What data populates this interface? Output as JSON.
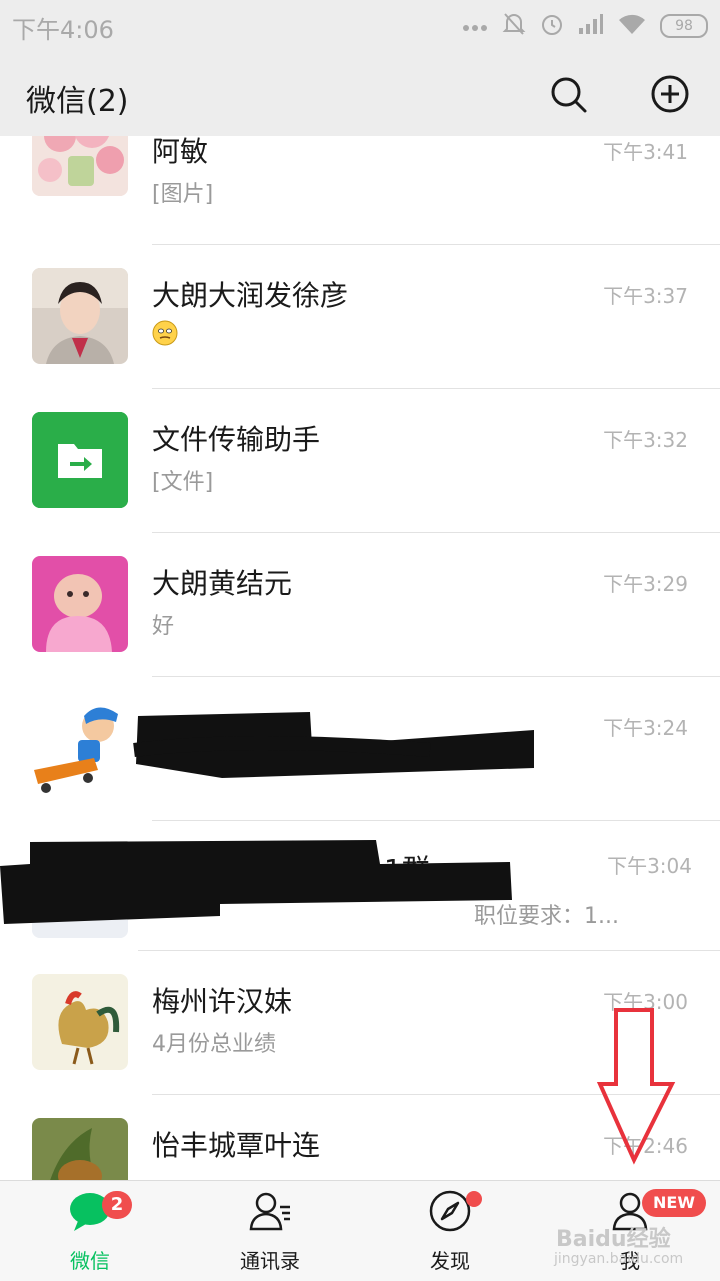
{
  "status_bar": {
    "time": "下午4:06",
    "battery": "98"
  },
  "header": {
    "title": "微信(2)"
  },
  "chats": [
    {
      "name": "阿敏",
      "message": "[图片]",
      "time": "下午3:41"
    },
    {
      "name": "大朗大润发徐彦",
      "message": "",
      "time": "下午3:37"
    },
    {
      "name": "文件传输助手",
      "message": "[文件]",
      "time": "下午3:32"
    },
    {
      "name": "大朗黄结元",
      "message": "好",
      "time": "下午3:29"
    },
    {
      "name": "",
      "message": "",
      "time": "下午3:24"
    },
    {
      "name": "1群",
      "message": "职位要求：1...",
      "time": "下午3:04"
    },
    {
      "name": "梅州许汉妹",
      "message": "4月份总业绩",
      "time": "下午3:00"
    },
    {
      "name": "怡丰城覃叶连",
      "message": "",
      "time": "下午2:46"
    }
  ],
  "tabs": [
    {
      "label": "微信",
      "badge": "2"
    },
    {
      "label": "通讯录"
    },
    {
      "label": "发现"
    },
    {
      "label": "我",
      "badge": "NEW"
    }
  ],
  "watermark": {
    "brand": "Baidu经验",
    "url": "jingyan.baidu.com"
  },
  "colors": {
    "accent": "#07c160",
    "badge": "#f04d4d",
    "annotation_arrow": "#e8323c"
  }
}
